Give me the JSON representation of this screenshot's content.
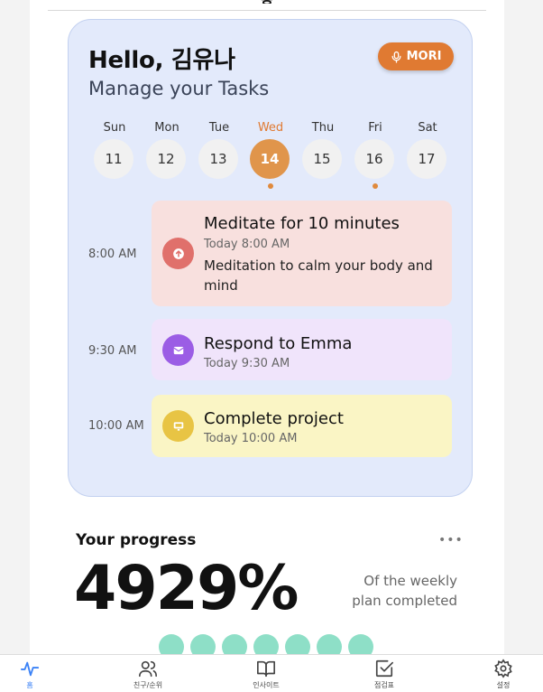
{
  "header": {
    "title": "홈"
  },
  "card": {
    "greeting": "Hello, 김유나",
    "subtitle": "Manage your Tasks",
    "mori_label": "MORI"
  },
  "week": [
    {
      "name": "Sun",
      "date": "11",
      "active": false,
      "dot": false
    },
    {
      "name": "Mon",
      "date": "12",
      "active": false,
      "dot": false
    },
    {
      "name": "Tue",
      "date": "13",
      "active": false,
      "dot": false
    },
    {
      "name": "Wed",
      "date": "14",
      "active": true,
      "dot": true
    },
    {
      "name": "Thu",
      "date": "15",
      "active": false,
      "dot": false
    },
    {
      "name": "Fri",
      "date": "16",
      "active": false,
      "dot": true
    },
    {
      "name": "Sat",
      "date": "17",
      "active": false,
      "dot": false
    }
  ],
  "tasks": [
    {
      "time": "8:00 AM",
      "title": "Meditate for 10 minutes",
      "subtitle": "Today 8:00 AM",
      "description": "Meditation to calm your body and mind",
      "icon": "arrow-up-icon",
      "bg": "#f8e0de",
      "icon_bg": "#e0706b"
    },
    {
      "time": "9:30 AM",
      "title": "Respond to Emma",
      "subtitle": "Today 9:30 AM",
      "description": "",
      "icon": "mail-icon",
      "bg": "#f0e4fb",
      "icon_bg": "#9b5de5"
    },
    {
      "time": "10:00 AM",
      "title": "Complete project",
      "subtitle": "Today 10:00 AM",
      "description": "",
      "icon": "monitor-icon",
      "bg": "#faf5c5",
      "icon_bg": "#e8c444"
    }
  ],
  "progress": {
    "title": "Your progress",
    "more_label": "•••",
    "value": "4929%",
    "note_line1": "Of the weekly",
    "note_line2": "plan completed",
    "circle_count": 7,
    "circle_color": "#8edfc7"
  },
  "nav": [
    {
      "label": "홈",
      "icon": "activity-icon",
      "active": true
    },
    {
      "label": "친구/순위",
      "icon": "users-icon",
      "active": false
    },
    {
      "label": "인사이트",
      "icon": "book-icon",
      "active": false
    },
    {
      "label": "점검표",
      "icon": "checkbox-icon",
      "active": false
    },
    {
      "label": "설정",
      "icon": "gear-icon",
      "active": false
    }
  ]
}
